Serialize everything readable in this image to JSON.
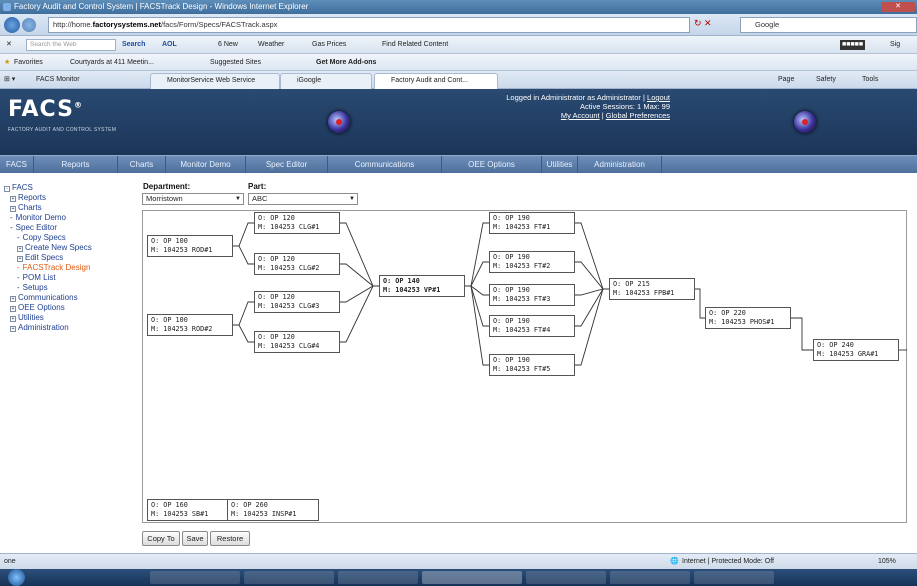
{
  "window": {
    "title": "Factory Audit and Control System | FACSTrack Design - Windows Internet Explorer"
  },
  "browser": {
    "url_prefix": "http://home.",
    "url_domain": "factorysystems.net",
    "url_path": "/facs/Form/Specs/FACSTrack.aspx",
    "search_engine": "Google",
    "toolbar": {
      "search_placeholder": "Search the Web",
      "search_button": "Search",
      "aol": "AOL",
      "news": "6 New",
      "weather": "Weather",
      "gas": "Gas Prices",
      "find": "Find Related Content",
      "sign": "Sig"
    },
    "favorites": {
      "label": "Favorites",
      "items": [
        "Courtyards at 411 Meetin...",
        "Suggested Sites",
        "Get More Add-ons"
      ]
    },
    "tabs": {
      "group": "FACS Monitor",
      "items": [
        "MonitorService Web Service",
        "iGoogle",
        "Factory Audit and Cont..."
      ]
    },
    "commands": [
      "Page",
      "Safety",
      "Tools"
    ],
    "status": {
      "left": "one",
      "zone": "Internet | Protected Mode: Off",
      "zoom": "105%"
    }
  },
  "app": {
    "logo": "FACS",
    "logo_sub": "FACTORY AUDIT AND CONTROL SYSTEM",
    "login": {
      "line1": "Logged in Administrator as Administrator |",
      "logout": "Logout",
      "line2": "Active Sessions: 1 Max: 99",
      "account": "My Account",
      "sep": "|",
      "prefs": "Global Preferences"
    },
    "menu": [
      "FACS",
      "Reports",
      "Charts",
      "Monitor Demo",
      "Spec Editor",
      "Communications",
      "OEE Options",
      "Utilities",
      "Administration"
    ],
    "sidebar": [
      {
        "label": "FACS",
        "level": 0,
        "marker": "-"
      },
      {
        "label": "Reports",
        "level": 1,
        "marker": "+"
      },
      {
        "label": "Charts",
        "level": 1,
        "marker": "+"
      },
      {
        "label": "Monitor Demo",
        "level": 1,
        "marker": "-"
      },
      {
        "label": "Spec Editor",
        "level": 1,
        "marker": "-"
      },
      {
        "label": "Copy Specs",
        "level": 2,
        "marker": "-"
      },
      {
        "label": "Create New Specs",
        "level": 2,
        "marker": "+"
      },
      {
        "label": "Edit Specs",
        "level": 2,
        "marker": "+"
      },
      {
        "label": "FACSTrack Design",
        "level": 2,
        "marker": "-",
        "active": true
      },
      {
        "label": "POM List",
        "level": 2,
        "marker": "-"
      },
      {
        "label": "Setups",
        "level": 2,
        "marker": "-"
      },
      {
        "label": "Communications",
        "level": 1,
        "marker": "+"
      },
      {
        "label": "OEE Options",
        "level": 1,
        "marker": "+"
      },
      {
        "label": "Utilities",
        "level": 1,
        "marker": "+"
      },
      {
        "label": "Administration",
        "level": 1,
        "marker": "+"
      }
    ],
    "department": {
      "label": "Department:",
      "value": "Morristown"
    },
    "part": {
      "label": "Part:",
      "value": "ABC"
    },
    "operations": [
      {
        "id": "rod1",
        "o": "O: OP 100",
        "m": "M: 104253 ROD#1"
      },
      {
        "id": "rod2",
        "o": "O: OP 100",
        "m": "M: 104253 ROD#2"
      },
      {
        "id": "clg1",
        "o": "O: OP 120",
        "m": "M: 104253 CLG#1"
      },
      {
        "id": "clg2",
        "o": "O: OP 120",
        "m": "M: 104253 CLG#2"
      },
      {
        "id": "clg3",
        "o": "O: OP 120",
        "m": "M: 104253 CLG#3"
      },
      {
        "id": "clg4",
        "o": "O: OP 120",
        "m": "M: 104253 CLG#4"
      },
      {
        "id": "vp1",
        "o": "O: OP 140",
        "m": "M: 104253 VP#1"
      },
      {
        "id": "ft1",
        "o": "O: OP 190",
        "m": "M: 104253 FT#1"
      },
      {
        "id": "ft2",
        "o": "O: OP 190",
        "m": "M: 104253 FT#2"
      },
      {
        "id": "ft3",
        "o": "O: OP 190",
        "m": "M: 104253 FT#3"
      },
      {
        "id": "ft4",
        "o": "O: OP 190",
        "m": "M: 104253 FT#4"
      },
      {
        "id": "ft5",
        "o": "O: OP 190",
        "m": "M: 104253 FT#5"
      },
      {
        "id": "fpb1",
        "o": "O: OP 215",
        "m": "M: 104253 FPB#1"
      },
      {
        "id": "phos1",
        "o": "O: OP 220",
        "m": "M: 104253 PHOS#1"
      },
      {
        "id": "gra1",
        "o": "O: OP 240",
        "m": "M: 104253 GRA#1"
      },
      {
        "id": "sb1",
        "o": "O: OP 160",
        "m": "M: 104253 SB#1"
      },
      {
        "id": "insp1",
        "o": "O: OP 260",
        "m": "M: 104253 INSP#1"
      }
    ],
    "buttons": {
      "copy_to": "Copy To",
      "save": "Save",
      "restore": "Restore"
    }
  }
}
